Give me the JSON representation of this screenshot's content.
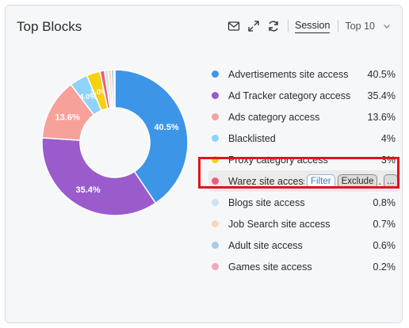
{
  "widget": {
    "title": "Top Blocks",
    "toolbar": {
      "view_label": "Session",
      "top_selector": "Top 10",
      "icons": [
        "mail-icon",
        "expand-icon",
        "refresh-icon",
        "chevron-down-icon"
      ]
    }
  },
  "chart_data": {
    "type": "pie",
    "categories": [
      "Advertisements site access",
      "Ad Tracker category access",
      "Ads category access",
      "Blacklisted",
      "Proxy category access",
      "Warez site access",
      "Blogs site access",
      "Job Search site access",
      "Adult site access",
      "Games site access"
    ],
    "values": [
      40.5,
      35.4,
      13.6,
      4,
      3,
      1,
      0.8,
      0.7,
      0.6,
      0.2
    ],
    "colors": [
      "#3d95e8",
      "#9a5bcc",
      "#f7a19b",
      "#8fd3f9",
      "#f5d113",
      "#ee5d7c",
      "#c9e4f3",
      "#fbd6b8",
      "#a8cce7",
      "#f3a8bf"
    ],
    "slice_labels": [
      "40.5%",
      "35.4%",
      "13.6%",
      "4.0%",
      "3.0%"
    ],
    "donut": true
  },
  "legend": {
    "items": [
      {
        "label": "Advertisements site access",
        "pct": "40.5%"
      },
      {
        "label": "Ad Tracker category access",
        "pct": "35.4%"
      },
      {
        "label": "Ads category access",
        "pct": "13.6%"
      },
      {
        "label": "Blacklisted",
        "pct": "4%"
      },
      {
        "label": "Proxy category access",
        "pct": "3%"
      },
      {
        "label": "Warez site access",
        "pct": ""
      },
      {
        "label": "Blogs site access",
        "pct": "0.8%"
      },
      {
        "label": "Job Search site access",
        "pct": "0.7%"
      },
      {
        "label": "Adult site access",
        "pct": "0.6%"
      },
      {
        "label": "Games site access",
        "pct": "0.2%"
      }
    ],
    "hover_row": 5,
    "hover_actions": {
      "filter_label": "Filter",
      "exclude_label": "Exclude",
      "trail_text": ".",
      "more_label": "..."
    }
  },
  "highlight_color": "#e0141e"
}
